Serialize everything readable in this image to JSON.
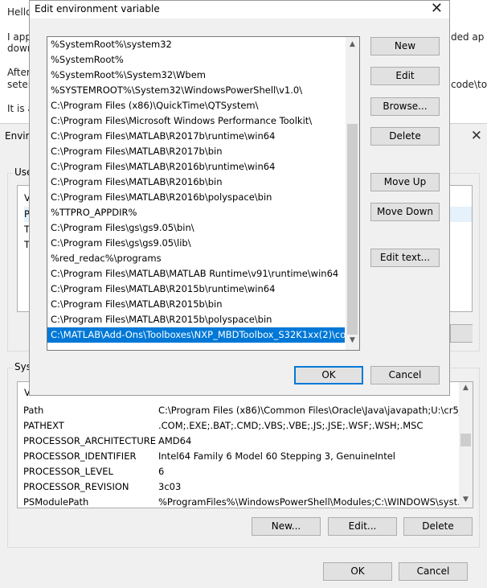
{
  "background_page": {
    "lines": [
      "Hello",
      "I app",
      "down",
      "After",
      "setei",
      "It is a"
    ],
    "right_fragments": [
      "ded ap",
      "code\\tool"
    ]
  },
  "env_dialog": {
    "title": "Enviro",
    "close_glyph": "✕",
    "user_group_label": "Use",
    "user_vars": {
      "header_fragment": "V",
      "rows": [
        "P",
        "T",
        "T"
      ]
    },
    "system_group_label": "Sys",
    "system_vars": {
      "header_fragment": "V",
      "rows": [
        {
          "name": "Path",
          "value": "C:\\Program Files (x86)\\Common Files\\Oracle\\Java\\javapath;U:\\cr5_..."
        },
        {
          "name": "PATHEXT",
          "value": ".COM;.EXE;.BAT;.CMD;.VBS;.VBE;.JS;.JSE;.WSF;.WSH;.MSC"
        },
        {
          "name": "PROCESSOR_ARCHITECTURE",
          "value": "AMD64"
        },
        {
          "name": "PROCESSOR_IDENTIFIER",
          "value": "Intel64 Family 6 Model 60 Stepping 3, GenuineIntel"
        },
        {
          "name": "PROCESSOR_LEVEL",
          "value": "6"
        },
        {
          "name": "PROCESSOR_REVISION",
          "value": "3c03"
        },
        {
          "name": "PSModulePath",
          "value": "%ProgramFiles%\\WindowsPowerShell\\Modules;C:\\WINDOWS\\syst..."
        }
      ]
    },
    "buttons": {
      "new": "New...",
      "edit": "Edit...",
      "delete": "Delete",
      "ok": "OK",
      "cancel": "Cancel"
    }
  },
  "edit_dialog": {
    "title": "Edit environment variable",
    "close_glyph": "✕",
    "paths": [
      "%SystemRoot%\\system32",
      "%SystemRoot%",
      "%SystemRoot%\\System32\\Wbem",
      "%SYSTEMROOT%\\System32\\WindowsPowerShell\\v1.0\\",
      "C:\\Program Files (x86)\\QuickTime\\QTSystem\\",
      "C:\\Program Files\\Microsoft Windows Performance Toolkit\\",
      "C:\\Program Files\\MATLAB\\R2017b\\runtime\\win64",
      "C:\\Program Files\\MATLAB\\R2017b\\bin",
      "C:\\Program Files\\MATLAB\\R2016b\\runtime\\win64",
      "C:\\Program Files\\MATLAB\\R2016b\\bin",
      "C:\\Program Files\\MATLAB\\R2016b\\polyspace\\bin",
      "%TTPRO_APPDIR%",
      "C:\\Program Files\\gs\\gs9.05\\bin\\",
      "C:\\Program Files\\gs\\gs9.05\\lib\\",
      "%red_redac%\\programs",
      "C:\\Program Files\\MATLAB\\MATLAB Runtime\\v91\\runtime\\win64",
      "C:\\Program Files\\MATLAB\\R2015b\\runtime\\win64",
      "C:\\Program Files\\MATLAB\\R2015b\\bin",
      "C:\\Program Files\\MATLAB\\R2015b\\polyspace\\bin",
      "C:\\MATLAB\\Add-Ons\\Toolboxes\\NXP_MBDToolbox_S32K1xx(2)\\co..."
    ],
    "selected_index": 19,
    "buttons": {
      "new": "New",
      "edit": "Edit",
      "browse": "Browse...",
      "delete": "Delete",
      "move_up": "Move Up",
      "move_down": "Move Down",
      "edit_text": "Edit text...",
      "ok": "OK",
      "cancel": "Cancel"
    },
    "accent_color": "#0078d7"
  }
}
